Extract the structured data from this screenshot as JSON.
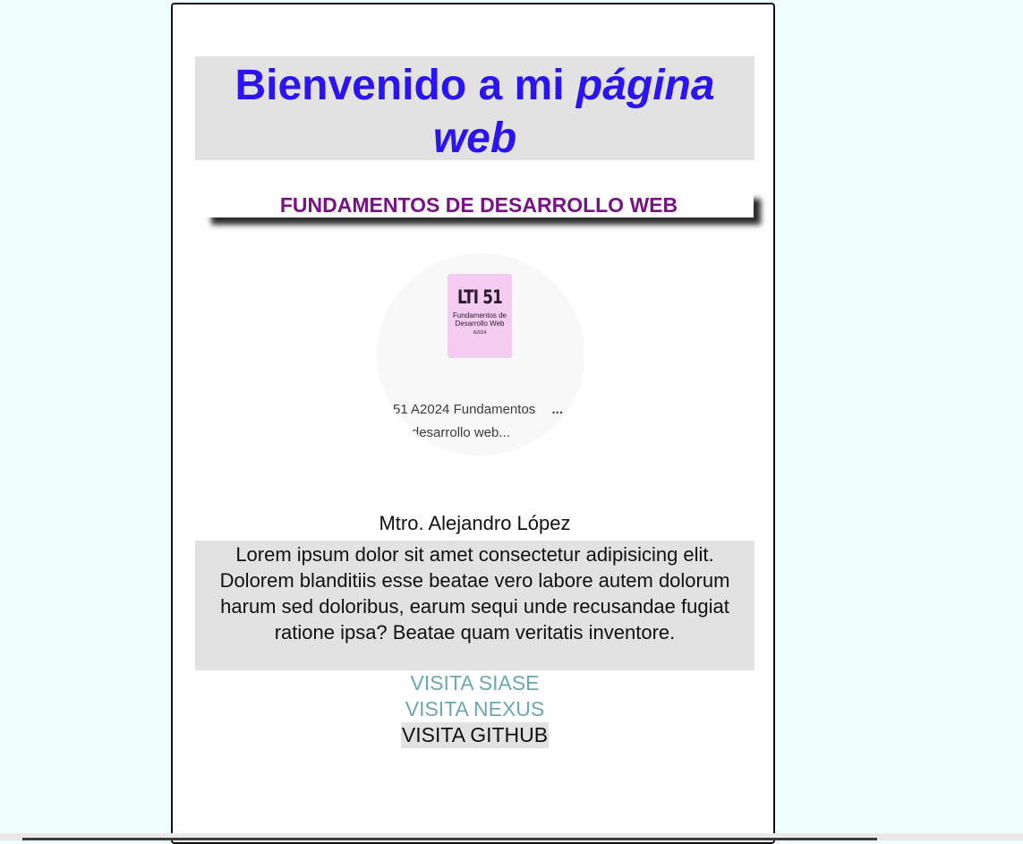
{
  "header": {
    "title_plain": "Bienvenido a mi",
    "title_emphasis": "página web",
    "subtitle": "FUNDAMENTOS DE DESARROLLO WEB"
  },
  "image": {
    "cover_code": "LTI 51",
    "cover_subtitle": "Fundamentos de Desarrollo Web",
    "cover_small": "A2024",
    "caption_line1": "51 A2024 Fundamentos",
    "caption_line2": "de desarrollo web...",
    "caption_more": "...",
    "colors": {
      "cover": "#f4cbf1"
    }
  },
  "teacher": "Mtro. Alejandro López",
  "body_text": "Lorem ipsum dolor sit amet consectetur adipisicing elit. Dolorem blanditiis esse beatae vero labore autem dolorum harum sed doloribus, earum sequi unde recusandae fugiat ratione ipsa? Beatae quam veritatis inventore.",
  "links": [
    {
      "label": "VISITA SIASE"
    },
    {
      "label": "VISITA NEXUS"
    },
    {
      "label": "VISITA GITHUB"
    }
  ],
  "colors": {
    "page_bg": "#f0fffe",
    "title": "#2a14f5",
    "subtitle": "#7a1285",
    "link": "#6da8ae",
    "panel": "#e2e2e2"
  }
}
